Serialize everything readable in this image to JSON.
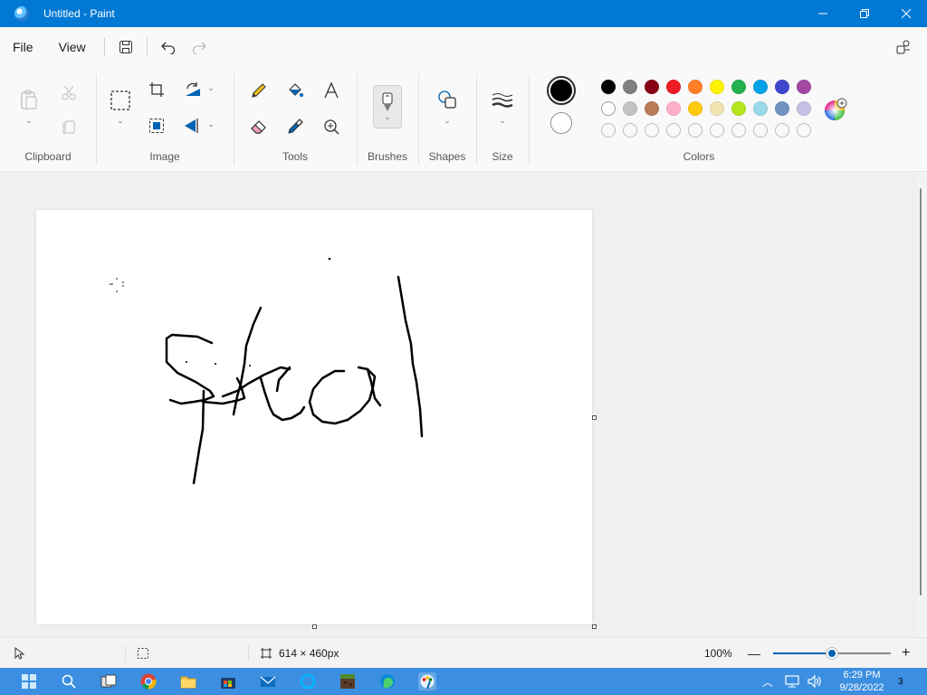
{
  "window": {
    "title": "Untitled - Paint"
  },
  "menu": {
    "file": "File",
    "view": "View"
  },
  "ribbon": {
    "groups": {
      "clipboard": "Clipboard",
      "image": "Image",
      "tools": "Tools",
      "brushes": "Brushes",
      "shapes": "Shapes",
      "size": "Size",
      "colors": "Colors"
    }
  },
  "colors": {
    "primary": "#000000",
    "secondary": "#ffffff",
    "palette_row1": [
      "#000000",
      "#7f7f7f",
      "#880015",
      "#ed1c24",
      "#ff7f27",
      "#fff200",
      "#22b14c",
      "#00a2e8",
      "#3f48cc",
      "#a349a4"
    ],
    "palette_row2": [
      "#ffffff",
      "#c3c3c3",
      "#b97a57",
      "#ffaec9",
      "#ffc90e",
      "#efe4b0",
      "#b5e61d",
      "#99d9ea",
      "#7092be",
      "#c8bfe7"
    ],
    "palette_row3_empty": 10
  },
  "status": {
    "canvas_size": "614 × 460px",
    "zoom": "100%",
    "zoom_level": 0.5
  },
  "taskbar": {
    "time": "6:29 PM",
    "date": "9/28/2022",
    "notifications": "3"
  }
}
